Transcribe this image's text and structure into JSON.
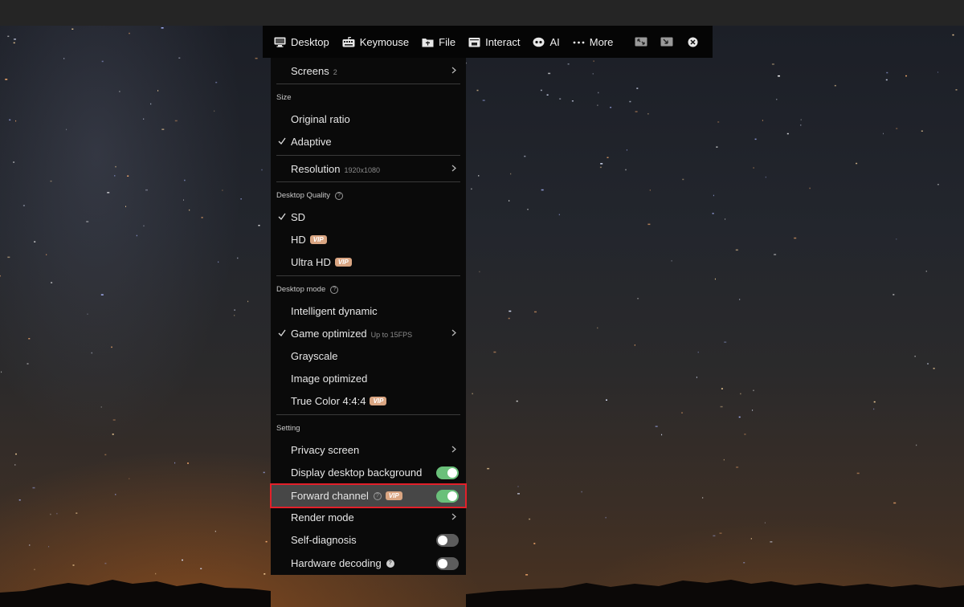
{
  "toolbar": {
    "items": [
      {
        "label": "Desktop",
        "icon": "monitor-icon"
      },
      {
        "label": "Keymouse",
        "icon": "keyboard-icon"
      },
      {
        "label": "File",
        "icon": "folder-icon"
      },
      {
        "label": "Interact",
        "icon": "interact-icon"
      },
      {
        "label": "AI",
        "icon": "eye-icon"
      },
      {
        "label": "More",
        "icon": "more-dots-icon"
      }
    ],
    "icon_buttons": [
      "minimize-window-icon",
      "exit-fullscreen-icon",
      "close-icon"
    ]
  },
  "menu": {
    "screens": {
      "label": "Screens",
      "count": "2"
    },
    "size": {
      "title": "Size",
      "original_ratio": "Original ratio",
      "adaptive": "Adaptive",
      "selected": "Adaptive"
    },
    "resolution": {
      "label": "Resolution",
      "value": "1920x1080"
    },
    "quality": {
      "title": "Desktop Quality",
      "sd": "SD",
      "hd": "HD",
      "ultra_hd": "Ultra HD",
      "selected": "SD"
    },
    "mode": {
      "title": "Desktop mode",
      "intelligent": "Intelligent dynamic",
      "game": "Game optimized",
      "game_note": "Up to 15FPS",
      "grayscale": "Grayscale",
      "image": "Image optimized",
      "true_color": "True Color 4:4:4",
      "selected": "Game optimized"
    },
    "setting": {
      "title": "Setting",
      "privacy": "Privacy screen",
      "display_bg": "Display desktop background",
      "display_bg_on": true,
      "forward": "Forward channel",
      "forward_on": true,
      "render": "Render mode",
      "self_diag": "Self-diagnosis",
      "self_diag_on": false,
      "hw_decoding": "Hardware decoding",
      "hw_decoding_on": false
    },
    "vip_badge": "VIP"
  },
  "colors": {
    "toggle_on": "#6ac07a",
    "toggle_off": "#5c5c5c",
    "vip_badge": "#d9a582",
    "highlight_border": "#e3202a"
  }
}
